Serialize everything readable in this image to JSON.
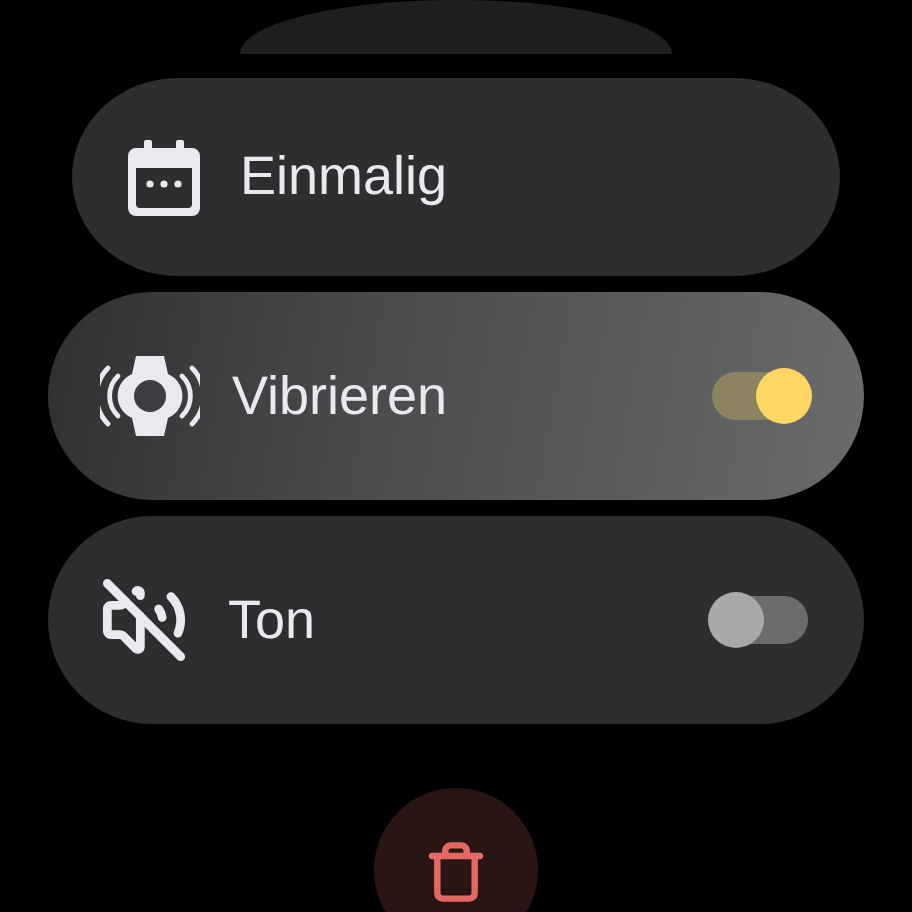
{
  "chips": [
    {
      "kind": "plain",
      "label": "Einmalig"
    },
    {
      "kind": "toggle",
      "label": "Vibrieren",
      "on": true
    },
    {
      "kind": "toggle",
      "label": "Ton",
      "on": false
    }
  ]
}
